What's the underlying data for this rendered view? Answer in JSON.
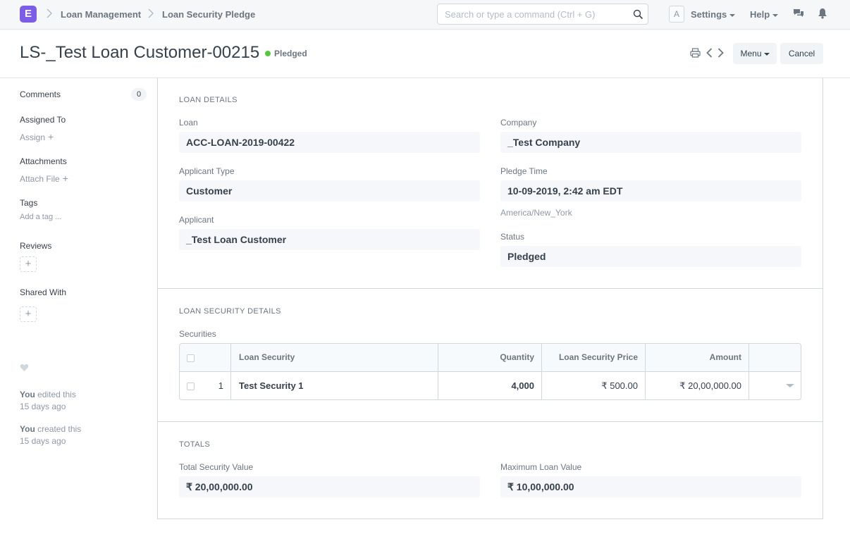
{
  "navbar": {
    "logo_letter": "E",
    "breadcrumbs": [
      "Loan Management",
      "Loan Security Pledge"
    ],
    "search_placeholder": "Search or type a command (Ctrl + G)",
    "avatar_letter": "A",
    "settings_label": "Settings",
    "help_label": "Help"
  },
  "page": {
    "title": "LS-_Test Loan Customer-00215",
    "status": "Pledged",
    "menu_label": "Menu",
    "cancel_label": "Cancel"
  },
  "sidebar": {
    "comments_label": "Comments",
    "comments_count": "0",
    "assigned_label": "Assigned To",
    "assign_link": "Assign",
    "attachments_label": "Attachments",
    "attach_link": "Attach File",
    "tags_label": "Tags",
    "add_tag_link": "Add a tag ...",
    "reviews_label": "Reviews",
    "shared_label": "Shared With",
    "activity": [
      {
        "user": "You",
        "action": "edited this",
        "when": "15 days ago"
      },
      {
        "user": "You",
        "action": "created this",
        "when": "15 days ago"
      }
    ]
  },
  "loan_details": {
    "heading": "LOAN DETAILS",
    "loan_label": "Loan",
    "loan_value": "ACC-LOAN-2019-00422",
    "applicant_type_label": "Applicant Type",
    "applicant_type_value": "Customer",
    "applicant_label": "Applicant",
    "applicant_value": "_Test Loan Customer",
    "company_label": "Company",
    "company_value": "_Test Company",
    "pledge_time_label": "Pledge Time",
    "pledge_time_value": "10-09-2019, 2:42 am EDT",
    "timezone": "America/New_York",
    "status_label": "Status",
    "status_value": "Pledged"
  },
  "security_details": {
    "heading": "LOAN SECURITY DETAILS",
    "table_label": "Securities",
    "columns": [
      "Loan Security",
      "Quantity",
      "Loan Security Price",
      "Amount"
    ],
    "rows": [
      {
        "idx": "1",
        "loan_security": "Test Security 1",
        "quantity": "4,000",
        "price": "₹ 500.00",
        "amount": "₹ 20,00,000.00"
      }
    ]
  },
  "totals": {
    "heading": "TOTALS",
    "total_label": "Total Security Value",
    "total_value": "₹ 20,00,000.00",
    "max_label": "Maximum Loan Value",
    "max_value": "₹ 10,00,000.00"
  },
  "colors": {
    "brand": "#7c5de6",
    "status_green": "#5ac53e"
  }
}
